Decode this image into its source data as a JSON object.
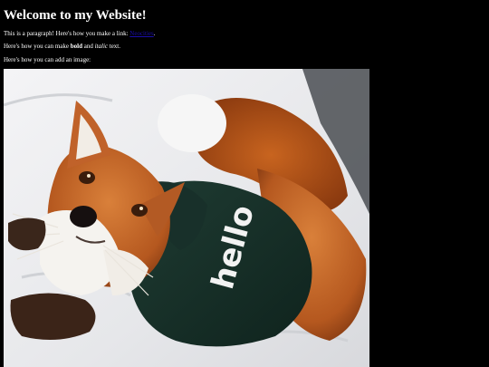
{
  "page": {
    "heading": "Welcome to my Website!",
    "paragraph1": {
      "before": "This is a paragraph! Here's how you make a link: ",
      "link_text": "Neocities",
      "after": "."
    },
    "paragraph2": {
      "before": "Here's how you can make ",
      "bold": "bold",
      "middle": " and ",
      "italic": "italic",
      "after": " text."
    },
    "paragraph3": "Here's how you can add an image:",
    "image": {
      "subject": "fox-wearing-green-hoodie",
      "hoodie_text": "hello"
    }
  },
  "colors": {
    "background": "#000000",
    "text": "#ffffff",
    "link": "#1a0dab"
  }
}
